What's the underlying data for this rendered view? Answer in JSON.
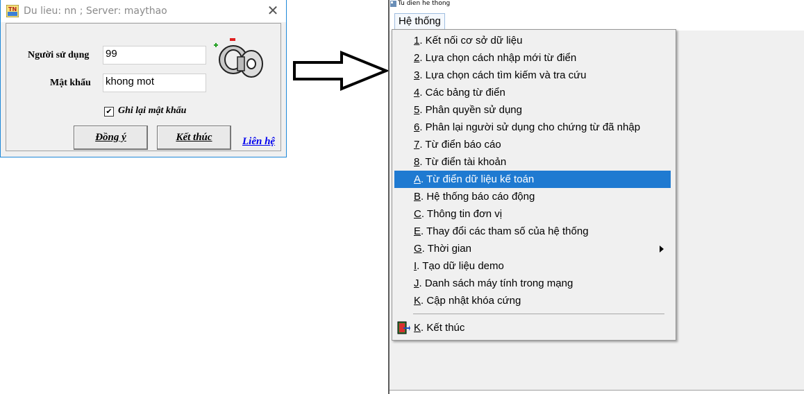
{
  "login": {
    "title": "Du lieu: nn ; Server: maythao",
    "close": "✕",
    "user_label": "Người sử dụng",
    "user_value": "99",
    "pass_label": "Mật khẩu",
    "pass_value": "khong mot",
    "remember_checked": "✔",
    "remember_label": "Ghi lại mật khẩu",
    "ok_button": "Đồng ý",
    "exit_button": "Kết thúc",
    "contact_link": "Liên hệ"
  },
  "app": {
    "window_title": "Tu dien he thong",
    "menu_title": "Hệ thống"
  },
  "menu": {
    "items": [
      {
        "key": "1",
        "label": ". Kết nối cơ sở dữ liệu"
      },
      {
        "key": "2",
        "label": ". Lựa chọn cách nhập  mới từ điển"
      },
      {
        "key": "3",
        "label": ". Lựa chọn cách tìm kiếm và tra cứu"
      },
      {
        "key": "4",
        "label": ". Các bảng từ điển"
      },
      {
        "key": "5",
        "label": ". Phân quyền sử dụng"
      },
      {
        "key": "6",
        "label": ". Phân lại người sử dụng cho chứng từ đã nhập"
      },
      {
        "key": "7",
        "label": ". Từ điển báo cáo"
      },
      {
        "key": "8",
        "label": ". Từ điển tài khoản"
      },
      {
        "key": "A",
        "label": ". Từ điển dữ liệu kế toán"
      },
      {
        "key": "B",
        "label": ". Hệ thống báo cáo động"
      },
      {
        "key": "C",
        "label": ". Thông tin đơn vị"
      },
      {
        "key": "E",
        "label": ". Thay đổi các tham số của hệ thống"
      },
      {
        "key": "G",
        "label": ". Thời gian"
      },
      {
        "key": "I",
        "label": ". Tạo dữ liệu demo"
      },
      {
        "key": "J",
        "label": ". Danh sách máy tính trong mạng"
      },
      {
        "key": "K",
        "label": ". Cập nhật khóa cứng"
      }
    ],
    "exit": {
      "key": "K",
      "label": ". Kết thúc"
    },
    "highlighted_index": 8,
    "highlight_color": "#1f7ad1"
  }
}
